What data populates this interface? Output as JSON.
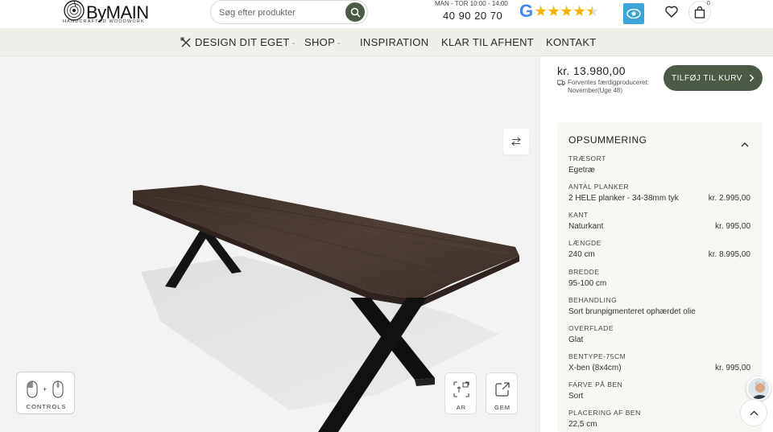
{
  "header": {
    "logo_text": "ByMAIN",
    "logo_sub": "HANDCRAFTED WOODWORK",
    "search_placeholder": "Søg efter produkter",
    "hours": "MAN - TOR 10:00 - 14:00",
    "phone": "40 90 20 70",
    "google_rating": 4.5,
    "cart_count": "0"
  },
  "nav": {
    "items": [
      {
        "label": "DESIGN DIT EGET"
      },
      {
        "label": "SHOP"
      },
      {
        "label": "INSPIRATION"
      },
      {
        "label": "KLAR TIL AFHENT"
      },
      {
        "label": "KONTAKT"
      }
    ]
  },
  "viewer": {
    "controls_label": "CONTROLS",
    "ar_label": "AR",
    "save_label": "GEM"
  },
  "product": {
    "price": "kr. 13.980,00",
    "delivery_line1": "Forventes færdigproduceret:",
    "delivery_line2": "November(Uge 48)",
    "add_to_cart": "TILFØJ TIL KURV"
  },
  "summary": {
    "title": "OPSUMMERING",
    "rows": [
      {
        "label": "TRÆSORT",
        "value": "Egetræ",
        "price": ""
      },
      {
        "label": "ANTAL PLANKER",
        "value": "2 HELE planker - 34-38mm tyk",
        "price": "kr. 2.995,00"
      },
      {
        "label": "KANT",
        "value": "Naturkant",
        "price": "kr. 995,00"
      },
      {
        "label": "LÆNGDE",
        "value": "240 cm",
        "price": "kr. 8.995,00"
      },
      {
        "label": "BREDDE",
        "value": "95-100 cm",
        "price": ""
      },
      {
        "label": "BEHANDLING",
        "value": "Sort brunpigmenteret ophærdet olie",
        "price": ""
      },
      {
        "label": "OVERFLADE",
        "value": "Glat",
        "price": ""
      },
      {
        "label": "BENTYPE-75CM",
        "value": "X-ben (8x4cm)",
        "price": "kr. 995,00"
      },
      {
        "label": "FARVE PÅ BEN",
        "value": "Sort",
        "price": ""
      },
      {
        "label": "PLACERING AF BEN",
        "value": "22,5 cm",
        "price": ""
      }
    ]
  },
  "colors": {
    "brand_green": "#4a5a45",
    "nav_bg": "#f1efea",
    "viewer_bg": "#f3f3f3",
    "table_top": "#4a3b33",
    "legs": "#111111"
  }
}
